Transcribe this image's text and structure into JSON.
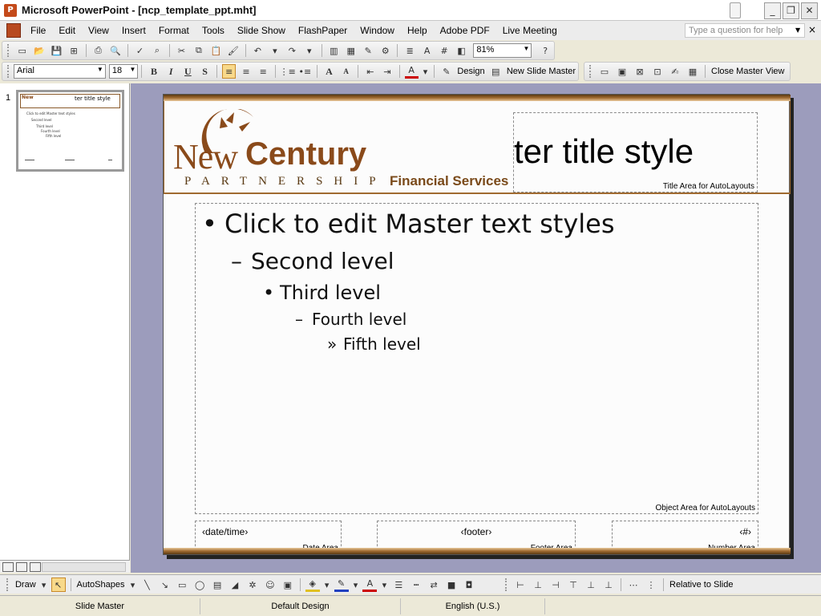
{
  "window": {
    "title": "Microsoft PowerPoint - [ncp_template_ppt.mht]",
    "buttons": [
      "_",
      "❐",
      "✕"
    ]
  },
  "menu": {
    "items": [
      "File",
      "Edit",
      "View",
      "Insert",
      "Format",
      "Tools",
      "Slide Show",
      "FlashPaper",
      "Window",
      "Help",
      "Adobe PDF",
      "Live Meeting"
    ],
    "help_placeholder": "Type a question for help",
    "close_glyph": "×"
  },
  "standard_toolbar": {
    "zoom": "81%"
  },
  "formatting_toolbar": {
    "font": "Arial",
    "size": "18",
    "bold": "B",
    "italic": "I",
    "underline": "U",
    "shadow": "S",
    "grow_font": "A",
    "shrink_font": "A",
    "design_label": "Design",
    "new_slide_master_label": "New Slide Master"
  },
  "master_toolbar": {
    "close_master_view_label": "Close Master View"
  },
  "thumbnails": [
    {
      "number": "1"
    }
  ],
  "slide": {
    "logo": {
      "word1": "New",
      "word2": "Century",
      "partnership": "PARTNERSHIP",
      "tagline": "Financial Services"
    },
    "title_area": {
      "text": "ter title style",
      "label": "Title Area for AutoLayouts"
    },
    "object_area": {
      "label": "Object Area for AutoLayouts",
      "levels": [
        {
          "bullet": "•",
          "text": "Click to edit Master text styles"
        },
        {
          "bullet": "–",
          "text": "Second level"
        },
        {
          "bullet": "•",
          "text": "Third level"
        },
        {
          "bullet": "–",
          "text": "Fourth level"
        },
        {
          "bullet": "»",
          "text": "Fifth level"
        }
      ]
    },
    "date_area": {
      "value": "‹date/time›",
      "label": "Date Area"
    },
    "footer_area": {
      "value": "‹footer›",
      "label": "Footer Area"
    },
    "number_area": {
      "value": "‹#›",
      "label": "Number Area"
    }
  },
  "drawing_toolbar": {
    "draw_label": "Draw",
    "autoshapes_label": "AutoShapes",
    "relative_label": "Relative to Slide"
  },
  "status": {
    "view": "Slide Master",
    "design": "Default Design",
    "language": "English (U.S.)"
  }
}
